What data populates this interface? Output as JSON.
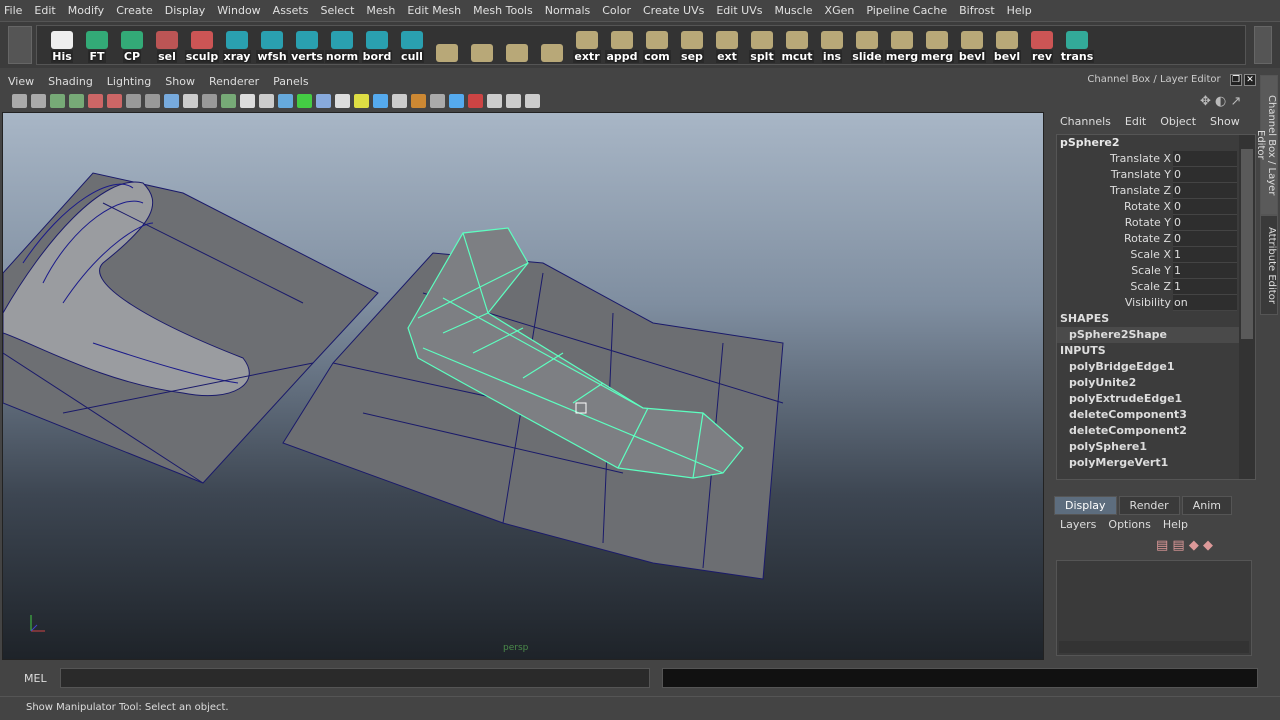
{
  "menubar": [
    "File",
    "Edit",
    "Modify",
    "Create",
    "Display",
    "Window",
    "Assets",
    "Select",
    "Mesh",
    "Edit Mesh",
    "Mesh Tools",
    "Normals",
    "Color",
    "Create UVs",
    "Edit UVs",
    "Muscle",
    "XGen",
    "Pipeline Cache",
    "Bifrost",
    "Help"
  ],
  "shelf": [
    {
      "label": "His",
      "icon": "pencil-icon",
      "color": "#eeeeee"
    },
    {
      "label": "FT",
      "icon": "axis-icon",
      "color": "#3a7"
    },
    {
      "label": "CP",
      "icon": "axis-icon",
      "color": "#3a7"
    },
    {
      "label": "sel",
      "icon": "brush-icon",
      "color": "#b55"
    },
    {
      "label": "sculp",
      "icon": "sculpt-icon",
      "color": "#c55"
    },
    {
      "label": "xray",
      "icon": "shader-icon",
      "color": "#2aa0b0"
    },
    {
      "label": "wfsh",
      "icon": "shader-icon",
      "color": "#2aa0b0"
    },
    {
      "label": "verts",
      "icon": "shader-icon",
      "color": "#2aa0b0"
    },
    {
      "label": "norm",
      "icon": "shader-icon",
      "color": "#2aa0b0"
    },
    {
      "label": "bord",
      "icon": "shader-icon",
      "color": "#2aa0b0"
    },
    {
      "label": "cull",
      "icon": "shader-icon",
      "color": "#2aa0b0"
    },
    {
      "label": "",
      "icon": "plane-icon",
      "color": "#b8a878"
    },
    {
      "label": "",
      "icon": "cube-icon",
      "color": "#b8a878"
    },
    {
      "label": "",
      "icon": "sphere-icon",
      "color": "#b8a878"
    },
    {
      "label": "",
      "icon": "cylinder-icon",
      "color": "#b8a878"
    },
    {
      "label": "extr",
      "icon": "extrude-icon",
      "color": "#b8a878"
    },
    {
      "label": "appd",
      "icon": "append-icon",
      "color": "#b8a878"
    },
    {
      "label": "com",
      "icon": "combine-icon",
      "color": "#b8a878"
    },
    {
      "label": "sep",
      "icon": "separate-icon",
      "color": "#b8a878"
    },
    {
      "label": "ext",
      "icon": "extract-icon",
      "color": "#b8a878"
    },
    {
      "label": "splt",
      "icon": "split-icon",
      "color": "#b8a878"
    },
    {
      "label": "mcut",
      "icon": "multicut-icon",
      "color": "#b8a878"
    },
    {
      "label": "ins",
      "icon": "insert-loop-icon",
      "color": "#b8a878"
    },
    {
      "label": "slide",
      "icon": "slide-icon",
      "color": "#b8a878"
    },
    {
      "label": "merg",
      "icon": "merge-icon",
      "color": "#b8a878"
    },
    {
      "label": "merg",
      "icon": "merge-icon",
      "color": "#b8a878"
    },
    {
      "label": "bevl",
      "icon": "bevel-icon",
      "color": "#b8a878"
    },
    {
      "label": "bevl",
      "icon": "bevel-icon",
      "color": "#b8a878"
    },
    {
      "label": "rev",
      "icon": "reverse-icon",
      "color": "#c55"
    },
    {
      "label": "trans",
      "icon": "transform-icon",
      "color": "#3a9"
    }
  ],
  "viewport": {
    "menu": [
      "View",
      "Shading",
      "Lighting",
      "Show",
      "Renderer",
      "Panels"
    ],
    "camera": "persp",
    "accent": "#5dffc0"
  },
  "channel_box": {
    "title": "Channel Box / Layer Editor",
    "menu": [
      "Channels",
      "Edit",
      "Object",
      "Show"
    ],
    "object": "pSphere2",
    "attributes": [
      {
        "name": "Translate X",
        "value": "0"
      },
      {
        "name": "Translate Y",
        "value": "0"
      },
      {
        "name": "Translate Z",
        "value": "0"
      },
      {
        "name": "Rotate X",
        "value": "0"
      },
      {
        "name": "Rotate Y",
        "value": "0"
      },
      {
        "name": "Rotate Z",
        "value": "0"
      },
      {
        "name": "Scale X",
        "value": "1"
      },
      {
        "name": "Scale Y",
        "value": "1"
      },
      {
        "name": "Scale Z",
        "value": "1"
      },
      {
        "name": "Visibility",
        "value": "on"
      }
    ],
    "shapes_label": "SHAPES",
    "shapes": [
      "pSphere2Shape"
    ],
    "inputs_label": "INPUTS",
    "inputs": [
      "polyBridgeEdge1",
      "polyUnite2",
      "polyExtrudeEdge1",
      "deleteComponent3",
      "deleteComponent2",
      "polySphere1",
      "polyMergeVert1"
    ]
  },
  "layer_editor": {
    "tabs": [
      "Display",
      "Render",
      "Anim"
    ],
    "active_tab": "Display",
    "menu": [
      "Layers",
      "Options",
      "Help"
    ]
  },
  "side_tabs": [
    "Channel Box / Layer Editor",
    "Attribute Editor"
  ],
  "command": {
    "mode": "MEL",
    "input": ""
  },
  "help_line": "Show Manipulator Tool: Select an object."
}
